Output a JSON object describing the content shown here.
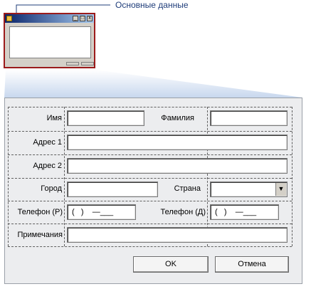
{
  "thumbnail": {
    "caption": "Основные данные",
    "title_buttons": [
      "_",
      "□",
      "x"
    ]
  },
  "form": {
    "first_name_label": "Имя",
    "last_name_label": "Фамилия",
    "address1_label": "Адрес 1",
    "address2_label": "Адрес 2",
    "city_label": "Город",
    "country_label": "Страна",
    "phone_work_label": "Телефон (Р)",
    "phone_home_label": "Телефон (Д)",
    "notes_label": "Примечания",
    "phone_mask": "(   )    —___",
    "dropdown_arrow": "▼",
    "ok_label": "OK",
    "cancel_label": "Отмена"
  },
  "colors": {
    "thumbnail_border": "#9b1b1b",
    "caption_text": "#1f3d7a",
    "form_background": "#ecedef"
  }
}
